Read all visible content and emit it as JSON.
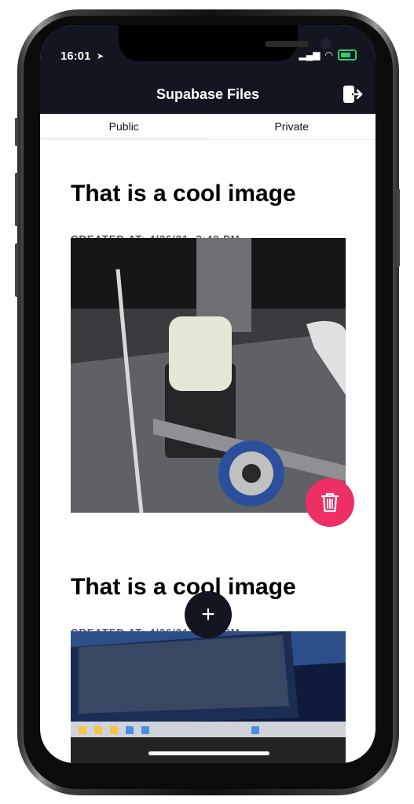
{
  "status": {
    "time": "16:01"
  },
  "header": {
    "title": "Supabase Files"
  },
  "tabs": [
    {
      "label": "Public"
    },
    {
      "label": "Private"
    }
  ],
  "posts": [
    {
      "title": "That is a cool image",
      "created": "CREATED AT: 4/26/21, 3:48 PM"
    },
    {
      "title": "That is a cool image",
      "created": "CREATED AT: 4/26/21, 3:30 PM"
    }
  ],
  "colors": {
    "nav_bg": "#131520",
    "delete": "#ee2f63"
  },
  "icons": {
    "logout": "logout-icon",
    "delete": "trash-icon",
    "add": "plus-icon"
  },
  "fab": {
    "add_label": "+"
  }
}
